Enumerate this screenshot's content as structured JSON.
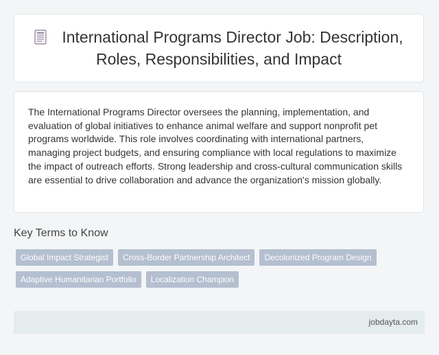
{
  "header": {
    "icon": "document-icon",
    "title": "International Programs Director Job: Description, Roles, Responsibilities, and Impact"
  },
  "description": "The International Programs Director oversees the planning, implementation, and evaluation of global initiatives to enhance animal welfare and support nonprofit pet programs worldwide. This role involves coordinating with international partners, managing project budgets, and ensuring compliance with local regulations to maximize the impact of outreach efforts. Strong leadership and cross-cultural communication skills are essential to drive collaboration and advance the organization's mission globally.",
  "key_terms": {
    "heading": "Key Terms to Know",
    "tags": [
      "Global Impact Strategist",
      "Cross-Border Partnership Architect",
      "Decolonized Program Design",
      "Adaptive Humanitarian Portfolio",
      "Localization Champion"
    ]
  },
  "footer": {
    "site": "jobdayta.com"
  },
  "colors": {
    "tag_bg": "#b4bfd0",
    "footer_bg": "#e4ecec"
  }
}
